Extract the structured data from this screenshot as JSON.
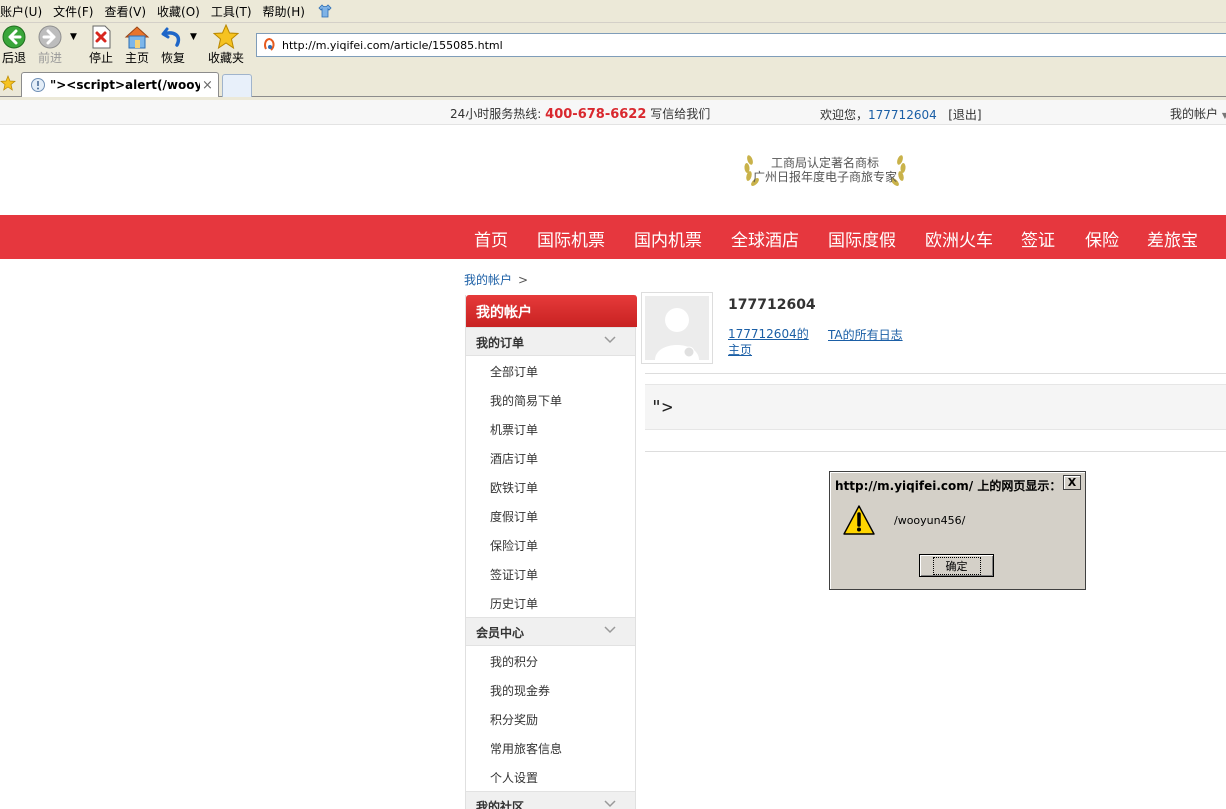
{
  "browser": {
    "menu": [
      "账户(U)",
      "文件(F)",
      "查看(V)",
      "收藏(O)",
      "工具(T)",
      "帮助(H)"
    ],
    "toolbar": {
      "back": "后退",
      "forward": "前进",
      "stop": "停止",
      "home": "主页",
      "restore": "恢复",
      "favorites": "收藏夹"
    },
    "address": "http://m.yiqifei.com/article/155085.html",
    "tab_title": "\"><script>alert(/wooy...",
    "tab_close": "×"
  },
  "topbar": {
    "hotline_label": "24小时服务热线:",
    "hotline_number": "400-678-6622",
    "write_us": "写信给我们",
    "welcome": "欢迎您，",
    "user_id": "177712604",
    "logout": "[退出]",
    "my_account": "我的帐户"
  },
  "award": {
    "line1": "工商局认定著名商标",
    "line2": "广州日报年度电子商旅专家"
  },
  "nav": [
    "首页",
    "国际机票",
    "国内机票",
    "全球酒店",
    "国际度假",
    "欧洲火车",
    "签证",
    "保险",
    "差旅宝"
  ],
  "breadcrumb": {
    "link": "我的帐户",
    "sep": ">"
  },
  "sidebar": {
    "title": "我的帐户",
    "groups": [
      {
        "title": "我的订单",
        "items": [
          "全部订单",
          "我的简易下单",
          "机票订单",
          "酒店订单",
          "欧铁订单",
          "度假订单",
          "保险订单",
          "签证订单",
          "历史订单"
        ]
      },
      {
        "title": "会员中心",
        "items": [
          "我的积分",
          "我的现金券",
          "积分奖励",
          "常用旅客信息",
          "个人设置"
        ]
      },
      {
        "title": "我的社区",
        "items": []
      }
    ]
  },
  "profile": {
    "username": "177712604",
    "home_link": "177712604的主页",
    "logs_link": "TA的所有日志"
  },
  "article_title": "\">",
  "dialog": {
    "caption": "http://m.yiqifei.com/ 上的网页显示：",
    "close": "X",
    "message": "/wooyun456/",
    "ok": "确定"
  }
}
